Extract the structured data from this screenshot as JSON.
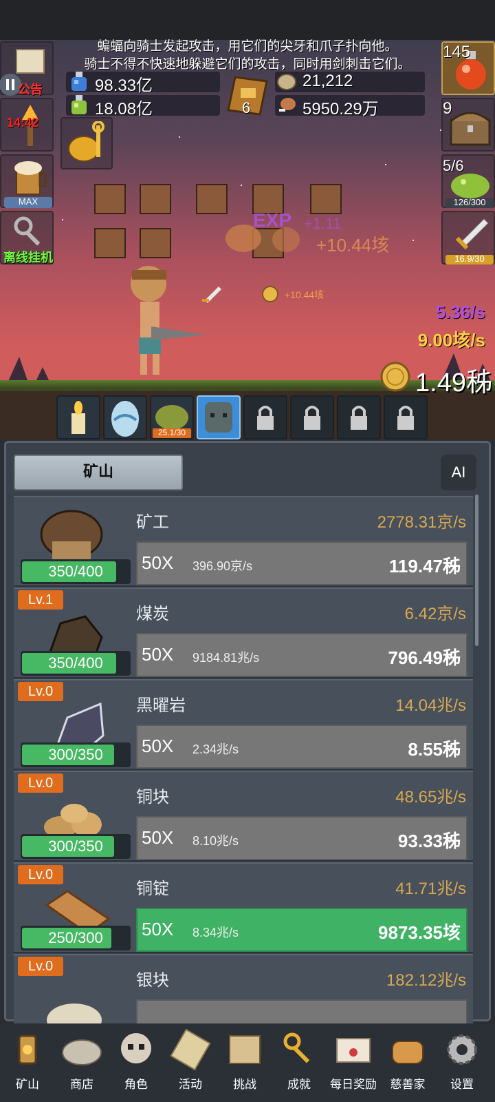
{
  "story": {
    "line1": "蝙蝠向骑士发起攻击，用它们的尖牙和爪子扑向他。",
    "line2": "骑士不得不快速地躲避它们的攻击，同时用剑刺击它们。"
  },
  "resources": {
    "blue_potion": "98.33亿",
    "green_potion": "18.08亿",
    "book_count": "6",
    "silver": "21,212",
    "meat": "5950.29万"
  },
  "left_side": {
    "notice_label": "公告",
    "torch_timer": "14:42",
    "ale_label": "MAX",
    "offline_label": "离线挂机"
  },
  "right_side": {
    "potion_count": "145",
    "chest_count": "9",
    "slime_count": "5/6",
    "slime_progress": "126/300",
    "sword_progress": "16.9/30"
  },
  "battle": {
    "exp_float": "+1.11",
    "coin_float": "+10.44垓",
    "small_exp": "EXP",
    "small_coin_float": "+10.44垓",
    "dps_purple": "5.36/s",
    "dps_gold": "9.00垓/s",
    "gold_total": "1.49秭"
  },
  "pets": {
    "slime_level": "25.1/30"
  },
  "panel": {
    "tab_label": "矿山",
    "ai_label": "AI"
  },
  "mine_rows": [
    {
      "level": "",
      "name": "矿工",
      "rate": "2778.31京/s",
      "cap": "350/400",
      "cap_fill": 0.875,
      "mult": "50X",
      "gain": "396.90京/s",
      "cost": "119.47秭",
      "affordable": false
    },
    {
      "level": "Lv.1",
      "name": "煤炭",
      "rate": "6.42京/s",
      "cap": "350/400",
      "cap_fill": 0.875,
      "mult": "50X",
      "gain": "9184.81兆/s",
      "cost": "796.49秭",
      "affordable": false
    },
    {
      "level": "Lv.0",
      "name": "黑曜岩",
      "rate": "14.04兆/s",
      "cap": "300/350",
      "cap_fill": 0.857,
      "mult": "50X",
      "gain": "2.34兆/s",
      "cost": "8.55秭",
      "affordable": false
    },
    {
      "level": "Lv.0",
      "name": "铜块",
      "rate": "48.65兆/s",
      "cap": "300/350",
      "cap_fill": 0.857,
      "mult": "50X",
      "gain": "8.10兆/s",
      "cost": "93.33秭",
      "affordable": false
    },
    {
      "level": "Lv.0",
      "name": "铜锭",
      "rate": "41.71兆/s",
      "cap": "250/300",
      "cap_fill": 0.833,
      "mult": "50X",
      "gain": "8.34兆/s",
      "cost": "9873.35垓",
      "affordable": true
    },
    {
      "level": "Lv.0",
      "name": "银块",
      "rate": "182.12兆/s",
      "cap": "",
      "cap_fill": 0,
      "mult": "",
      "gain": "",
      "cost": "",
      "affordable": false
    }
  ],
  "nav": [
    {
      "label": "矿山",
      "icon": "lantern-icon"
    },
    {
      "label": "商店",
      "icon": "stone-icon"
    },
    {
      "label": "角色",
      "icon": "skull-icon"
    },
    {
      "label": "活动",
      "icon": "scroll-icon"
    },
    {
      "label": "挑战",
      "icon": "map-icon"
    },
    {
      "label": "成就",
      "icon": "key-icon"
    },
    {
      "label": "每日奖励",
      "icon": "letter-icon"
    },
    {
      "label": "慈善家",
      "icon": "bread-icon"
    },
    {
      "label": "设置",
      "icon": "gear-icon"
    }
  ]
}
